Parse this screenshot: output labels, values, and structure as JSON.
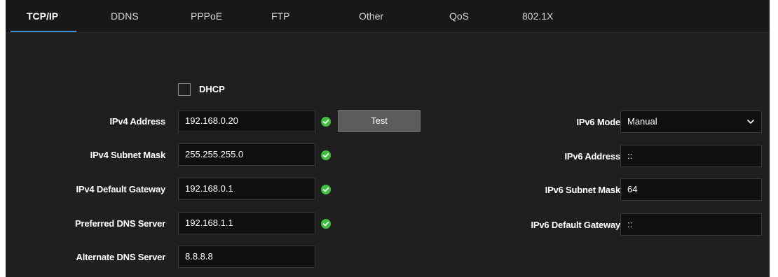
{
  "tabs": [
    {
      "label": "TCP/IP",
      "active": true
    },
    {
      "label": "DDNS"
    },
    {
      "label": "PPPoE"
    },
    {
      "label": "FTP"
    },
    {
      "label": "Other"
    },
    {
      "label": "QoS"
    },
    {
      "label": "802.1X"
    }
  ],
  "dhcp": {
    "label": "DHCP",
    "checked": false
  },
  "ipv4": {
    "address_label": "IPv4 Address",
    "address_value": "192.168.0.20",
    "subnet_label": "IPv4 Subnet Mask",
    "subnet_value": "255.255.255.0",
    "gateway_label": "IPv4 Default Gateway",
    "gateway_value": "192.168.0.1",
    "preferred_dns_label": "Preferred DNS Server",
    "preferred_dns_value": "192.168.1.1",
    "alternate_dns_label": "Alternate DNS Server",
    "alternate_dns_value": "8.8.8.8",
    "test_button": "Test"
  },
  "ipv6": {
    "mode_label": "IPv6 Mode",
    "mode_value": "Manual",
    "address_label": "IPv6 Address",
    "address_value": "::",
    "subnet_label": "IPv6 Subnet Mask",
    "subnet_value": "64",
    "gateway_label": "IPv6 Default Gateway",
    "gateway_value": "::"
  },
  "colors": {
    "accent": "#3a8fd9",
    "valid": "#3fbf3f",
    "background": "#1f1f1f"
  },
  "icons": {
    "valid": "check-circle-icon",
    "dropdown": "chevron-down-icon"
  }
}
